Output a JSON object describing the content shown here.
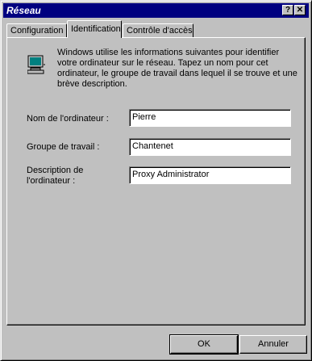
{
  "window": {
    "title": "Réseau",
    "help_label": "?",
    "close_label": "✕"
  },
  "tabs": [
    {
      "label": "Configuration",
      "active": false
    },
    {
      "label": "Identification",
      "active": true
    },
    {
      "label": "Contrôle d'accès",
      "active": false
    }
  ],
  "panel": {
    "icon": "network-computer-icon",
    "description": "Windows utilise les informations suivantes pour identifier votre ordinateur sur le réseau. Tapez un nom pour cet ordinateur, le groupe de travail dans lequel il se trouve et une brève description.",
    "fields": [
      {
        "label": "Nom de l'ordinateur :",
        "value": "Pierre"
      },
      {
        "label": "Groupe de travail :",
        "value": "Chantenet"
      },
      {
        "label_line1": "Description de",
        "label_line2": "l'ordinateur :",
        "value": "Proxy Administrator"
      }
    ]
  },
  "buttons": {
    "ok": "OK",
    "cancel": "Annuler"
  }
}
